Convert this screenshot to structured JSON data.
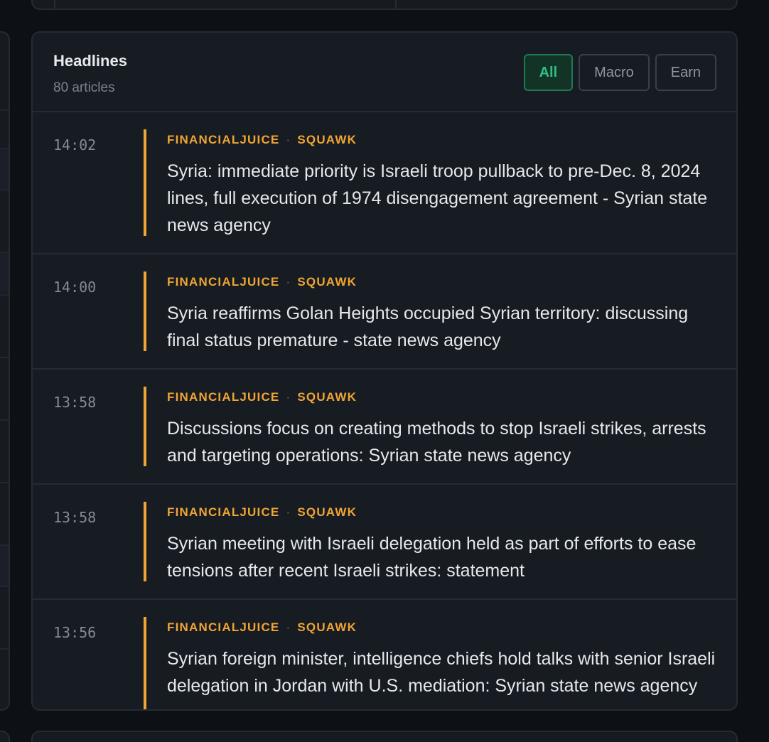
{
  "panel": {
    "title": "Headlines",
    "count": "80 articles"
  },
  "filters": [
    {
      "label": "All",
      "active": true
    },
    {
      "label": "Macro",
      "active": false
    },
    {
      "label": "Earn",
      "active": false
    }
  ],
  "articles": [
    {
      "time": "14:02",
      "source": "FINANCIALJUICE",
      "type": "SQUAWK",
      "headline": "Syria: immediate priority is Israeli troop pullback to pre-Dec. 8, 2024 lines, full execution of 1974 disengagement agreement - Syrian state news agency"
    },
    {
      "time": "14:00",
      "source": "FINANCIALJUICE",
      "type": "SQUAWK",
      "headline": "Syria reaffirms Golan Heights occupied Syrian territory: discussing final status premature - state news agency"
    },
    {
      "time": "13:58",
      "source": "FINANCIALJUICE",
      "type": "SQUAWK",
      "headline": "Discussions focus on creating methods to stop Israeli strikes, arrests and targeting operations: Syrian state news agency"
    },
    {
      "time": "13:58",
      "source": "FINANCIALJUICE",
      "type": "SQUAWK",
      "headline": "Syrian meeting with Israeli delegation held as part of efforts to ease tensions after recent Israeli strikes: statement"
    },
    {
      "time": "13:56",
      "source": "FINANCIALJUICE",
      "type": "SQUAWK",
      "headline": "Syrian foreign minister, intelligence chiefs hold talks with senior Israeli delegation in Jordan with U.S. mediation: Syrian state news agency"
    }
  ],
  "colors": {
    "accent": "#f0a534",
    "active_filter": "#2fbf83",
    "panel_bg": "#171b22"
  }
}
